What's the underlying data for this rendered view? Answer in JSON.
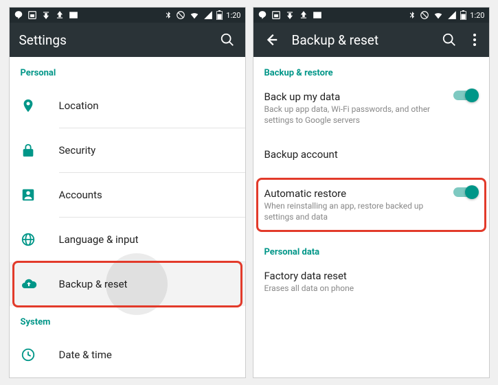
{
  "statusbar": {
    "time": "1:20"
  },
  "left": {
    "title": "Settings",
    "section_personal": "Personal",
    "items": [
      {
        "label": "Location"
      },
      {
        "label": "Security"
      },
      {
        "label": "Accounts"
      },
      {
        "label": "Language & input"
      },
      {
        "label": "Backup & reset"
      }
    ],
    "section_system": "System",
    "system_items": [
      {
        "label": "Date & time"
      }
    ]
  },
  "right": {
    "title": "Backup & reset",
    "section_backup": "Backup & restore",
    "backup_my_data": {
      "title": "Back up my data",
      "sub": "Back up app data, Wi-Fi passwords, and other settings to Google servers"
    },
    "backup_account": {
      "title": "Backup account"
    },
    "automatic_restore": {
      "title": "Automatic restore",
      "sub": "When reinstalling an app, restore backed up settings and data"
    },
    "section_personal_data": "Personal data",
    "factory_reset": {
      "title": "Factory data reset",
      "sub": "Erases all data on phone"
    }
  }
}
